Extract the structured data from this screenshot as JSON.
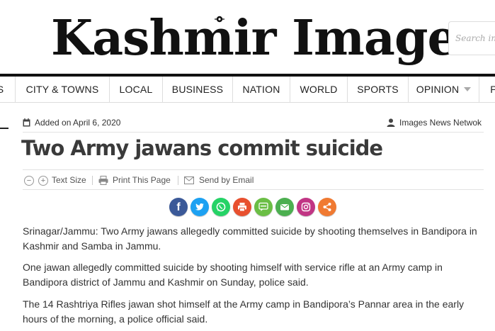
{
  "site": {
    "logo_text": "Kashmir Images",
    "search_placeholder": "Search in s"
  },
  "nav": {
    "items": [
      "S",
      "CITY & TOWNS",
      "LOCAL",
      "BUSINESS",
      "NATION",
      "WORLD",
      "SPORTS",
      "OPINION",
      "P"
    ]
  },
  "article": {
    "added_on": "Added on April 6, 2020",
    "author": "Images News Netwok",
    "headline": "Two Army jawans commit suicide",
    "tools": {
      "text_size": "Text Size",
      "print": "Print This Page",
      "email": "Send by Email",
      "minus": "−",
      "plus": "+"
    },
    "paragraphs": [
      "Srinagar/Jammu: Two Army jawans allegedly committed suicide by shooting themselves in Bandipora in Kashmir and Samba in Jammu.",
      "One jawan allegedly committed suicide by shooting himself with service rifle at an Army camp in Bandipora district of Jammu and Kashmir on Sunday, police said.",
      "The 14 Rashtriya Rifles jawan shot himself at the Army camp in Bandipora’s Pannar area in the early hours of the morning, a police official said."
    ]
  },
  "share": [
    {
      "name": "facebook",
      "icon": "facebook-icon",
      "glyph": "f",
      "color": "#3b5998"
    },
    {
      "name": "twitter",
      "icon": "twitter-icon",
      "glyph": "",
      "color": "#1da1f2"
    },
    {
      "name": "whatsapp",
      "icon": "whatsapp-icon",
      "glyph": "",
      "color": "#25d366"
    },
    {
      "name": "print",
      "icon": "print-icon",
      "glyph": "",
      "color": "#e8502f"
    },
    {
      "name": "sms",
      "icon": "sms-icon",
      "glyph": "",
      "color": "#6bbe45"
    },
    {
      "name": "email",
      "icon": "email-icon",
      "glyph": "",
      "color": "#4caf50"
    },
    {
      "name": "instagram",
      "icon": "instagram-icon",
      "glyph": "",
      "color": "#c13584"
    },
    {
      "name": "more",
      "icon": "share-icon",
      "glyph": "",
      "color": "#f07a32"
    }
  ]
}
